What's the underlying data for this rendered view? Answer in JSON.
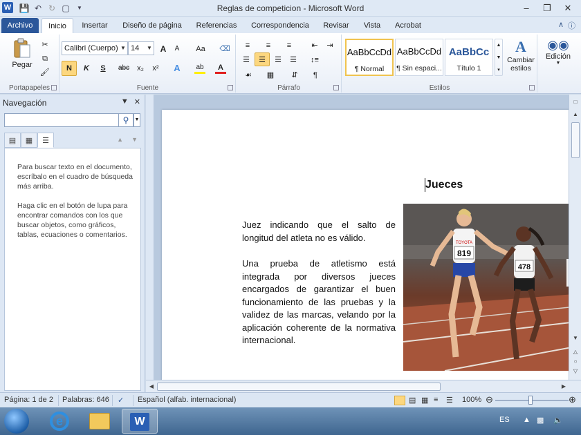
{
  "window": {
    "title": "Reglas de competicion - Microsoft Word",
    "app_icon_letter": "W"
  },
  "tabs": [
    "Archivo",
    "Inicio",
    "Insertar",
    "Diseño de página",
    "Referencias",
    "Correspondencia",
    "Revisar",
    "Vista",
    "Acrobat"
  ],
  "ribbon": {
    "clipboard": {
      "paste_label": "Pegar",
      "group_label": "Portapapeles"
    },
    "font": {
      "name": "Calibri (Cuerpo)",
      "size": "14",
      "group_label": "Fuente",
      "bold": "N",
      "italic": "K",
      "underline": "S",
      "strike": "abc",
      "sub": "x₂",
      "sup": "x²",
      "grow": "A",
      "shrink": "A",
      "case": "Aa"
    },
    "paragraph": {
      "group_label": "Párrafo"
    },
    "styles": {
      "group_label": "Estilos",
      "tiles": [
        {
          "sample": "AaBbCcDd",
          "name": "¶ Normal"
        },
        {
          "sample": "AaBbCcDd",
          "name": "¶ Sin espaci..."
        },
        {
          "sample": "AaBbCc",
          "name": "Título 1"
        }
      ],
      "change_styles_label": "Cambiar estilos"
    },
    "editing": {
      "label": "Edición"
    }
  },
  "navigation": {
    "title": "Navegación",
    "search_value": "",
    "message_1": "Para buscar texto en el documento, escríbalo en el cuadro de búsqueda más arriba.",
    "message_2": "Haga clic en el botón de lupa para encontrar comandos con los que buscar objetos, como gráficos, tablas, ecuaciones o comentarios."
  },
  "document": {
    "heading": "Jueces",
    "paragraph_1": "Juez indicando que el salto de longitud del atleta no es válido.",
    "paragraph_2": "Una prueba de atletismo está integrada por diversos jueces encargados de garantizar el buen funcionamiento de las pruebas y la validez de las marcas, velando por la aplicación coherente de la normativa internacional.",
    "bib_1": "819",
    "bib_2": "478",
    "sponsor": "TOYOTA"
  },
  "statusbar": {
    "page": "Página: 1 de 2",
    "words": "Palabras: 646",
    "language": "Español (alfab. internacional)",
    "zoom": "100%"
  },
  "taskbar": {
    "language": "ES"
  }
}
